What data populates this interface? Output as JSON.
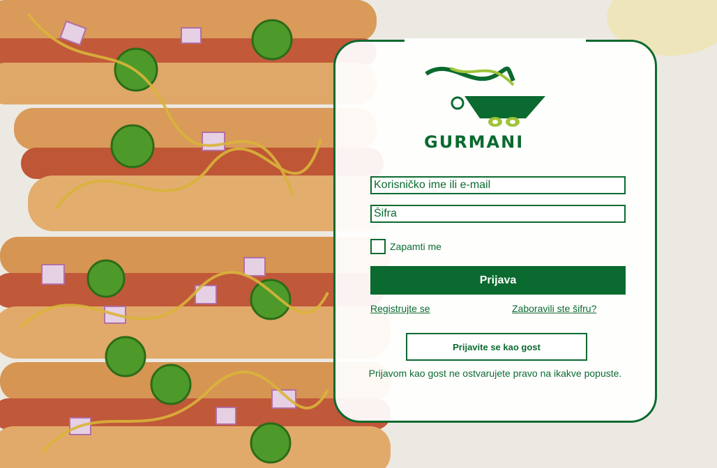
{
  "logo": {
    "text": "GURMANI"
  },
  "form": {
    "username_placeholder": "Korisničko ime ili e-mail",
    "password_placeholder": "Šifra",
    "remember_label": "Zapamti me",
    "login_label": "Prijava",
    "register_link": "Registrujte se",
    "forgot_link": "Zaboravili ste šifru?",
    "guest_label": "Prijavite se kao gost",
    "guest_note": "Prijavom kao gost ne ostvarujete pravo na ikakve popuste."
  },
  "colors": {
    "brand_green": "#0b6a2f",
    "accent_lime": "#9fc43a"
  }
}
